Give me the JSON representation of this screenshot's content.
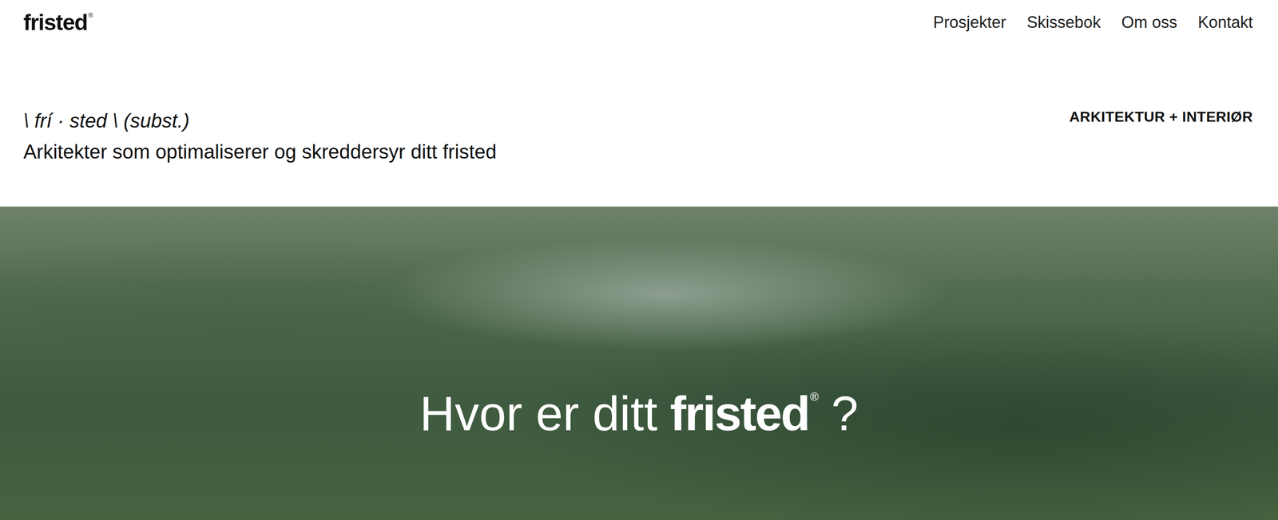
{
  "header": {
    "logo": {
      "text": "fristed",
      "mark": "®"
    },
    "nav": [
      {
        "label": "Prosjekter"
      },
      {
        "label": "Skissebok"
      },
      {
        "label": "Om oss"
      },
      {
        "label": "Kontakt"
      }
    ]
  },
  "intro": {
    "definition": "\\ frí · sted \\ (subst.)",
    "tagline": "Arkitekter som optimaliserer og skreddersyr ditt fristed",
    "category": "ARKITEKTUR + INTERIØR"
  },
  "hero": {
    "prefix": "Hvor er ditt",
    "brand": "fristed",
    "mark": "®",
    "suffix": "?"
  }
}
